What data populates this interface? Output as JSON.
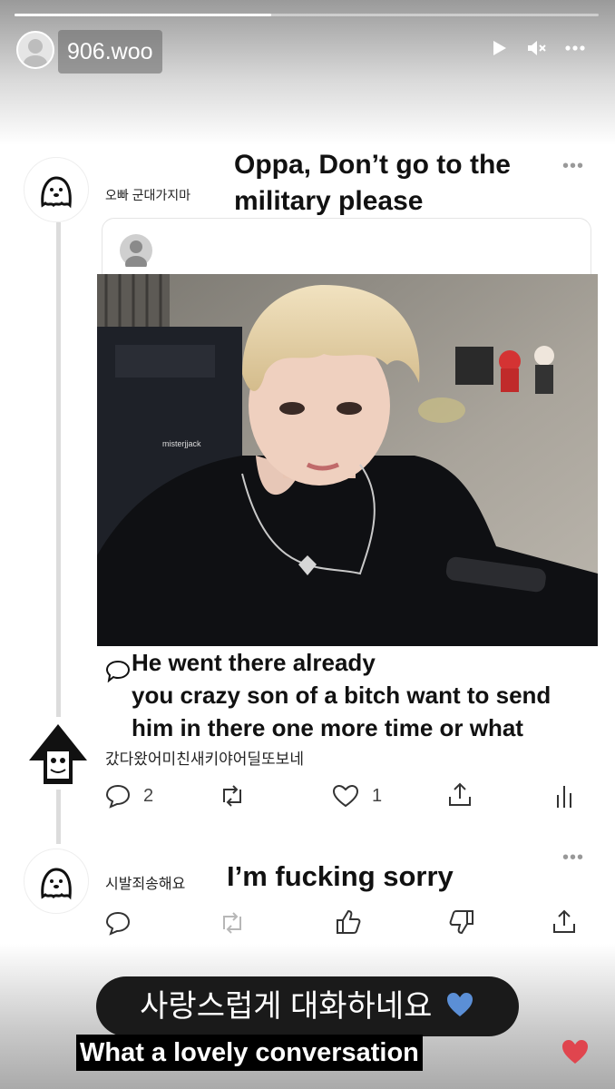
{
  "story": {
    "username": "906.woo",
    "progress": 0.44,
    "controls": [
      "play-icon",
      "mute-icon",
      "more-icon"
    ]
  },
  "post1": {
    "korean": "오빠 군대가지마",
    "caption_line1": "Oppa, Don’t go to the",
    "caption_line2": "military please",
    "more": "•••"
  },
  "reply": {
    "caption_line1": "He went there already",
    "caption_line2": "you crazy son of a bitch want to send",
    "caption_line3": "him in there one more time or what",
    "korean": "갔다왔어미친새키야어딜또보네",
    "stats": {
      "comments": "2",
      "likes": "1"
    },
    "photo_watermark": "misterjjack"
  },
  "post3": {
    "korean": "시발죄송해요",
    "caption": "I’m fucking sorry",
    "more": "•••"
  },
  "overlay": {
    "korean_text": "사랑스럽게 대화하네요",
    "english_text": "What a lovely conversation"
  },
  "colors": {
    "heart": "#e0454e",
    "heart_emoji": "#5b8fd6"
  }
}
